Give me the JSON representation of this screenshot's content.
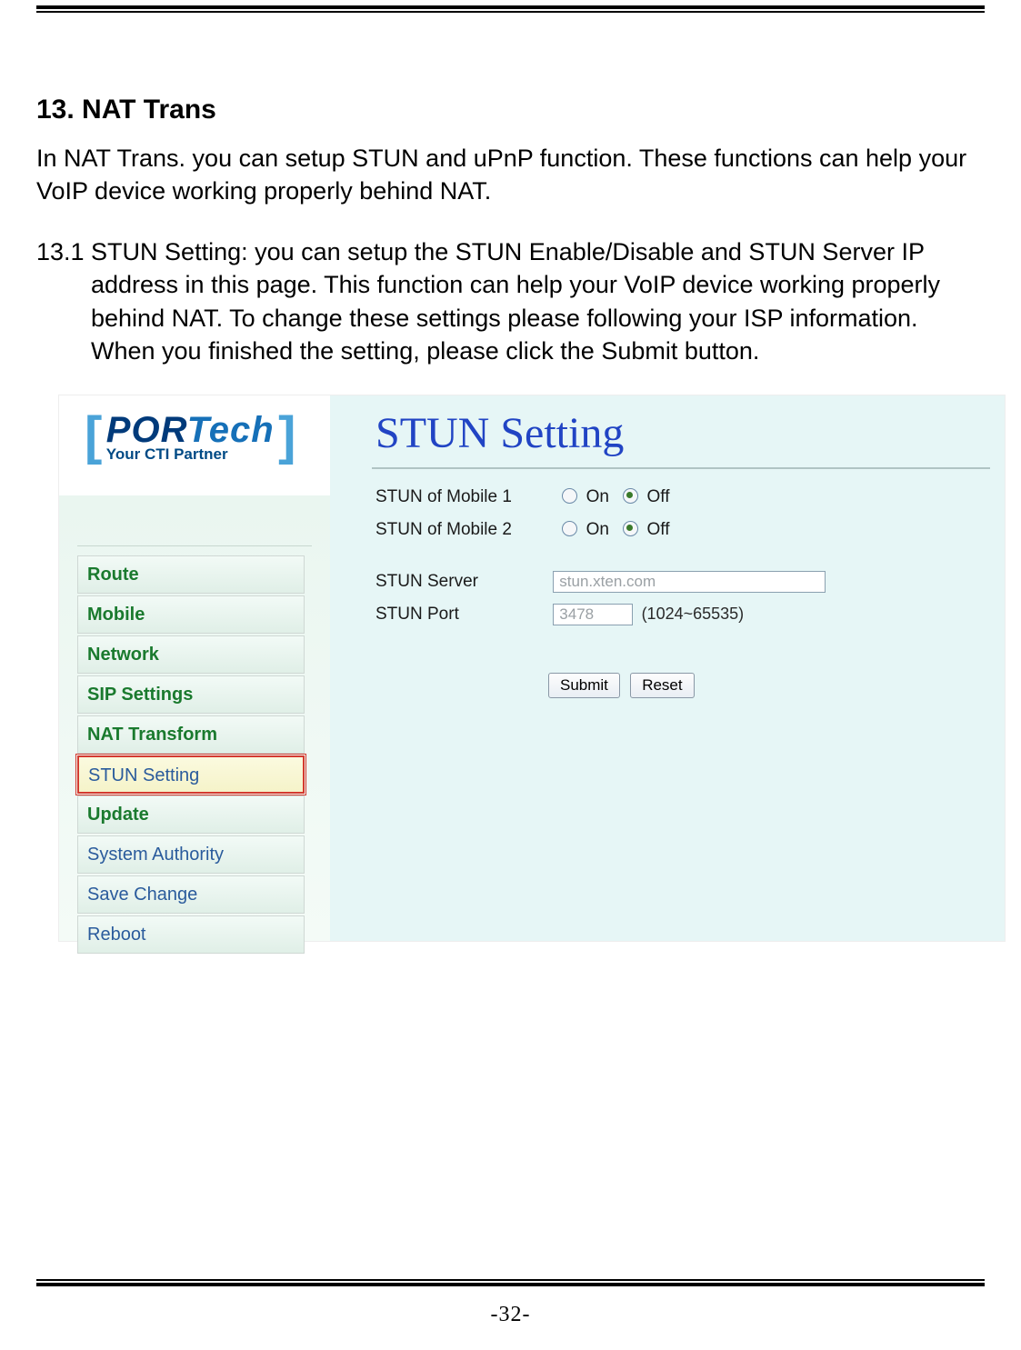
{
  "section": {
    "title": "13. NAT Trans",
    "intro": "In NAT Trans. you can setup STUN and uPnP function. These functions can help your VoIP device working properly behind NAT.",
    "sub": "13.1 STUN Setting: you can setup the STUN Enable/Disable and STUN Server IP address in this page. This function can help your VoIP device working properly behind NAT. To change these settings please following your ISP information. When you finished the setting, please click the Submit button."
  },
  "logo": {
    "part1": "POR",
    "part2": "Tech",
    "tagline": "Your CTI Partner"
  },
  "menu": {
    "items": [
      {
        "label": "Route",
        "type": "green"
      },
      {
        "label": "Mobile",
        "type": "green"
      },
      {
        "label": "Network",
        "type": "green"
      },
      {
        "label": "SIP Settings",
        "type": "green"
      },
      {
        "label": "NAT Transform",
        "type": "green"
      },
      {
        "label": "STUN Setting",
        "type": "sub"
      },
      {
        "label": "Update",
        "type": "green"
      },
      {
        "label": "System Authority",
        "type": "blue"
      },
      {
        "label": "Save Change",
        "type": "blue"
      },
      {
        "label": "Reboot",
        "type": "blue"
      }
    ]
  },
  "form": {
    "title": "STUN Setting",
    "mobile1_label": "STUN of Mobile 1",
    "mobile2_label": "STUN of Mobile 2",
    "on_label": "On",
    "off_label": "Off",
    "server_label": "STUN Server",
    "server_value": "stun.xten.com",
    "port_label": "STUN Port",
    "port_value": "3478",
    "port_range": "(1024~65535)",
    "submit": "Submit",
    "reset": "Reset"
  },
  "page_number": "-32-"
}
